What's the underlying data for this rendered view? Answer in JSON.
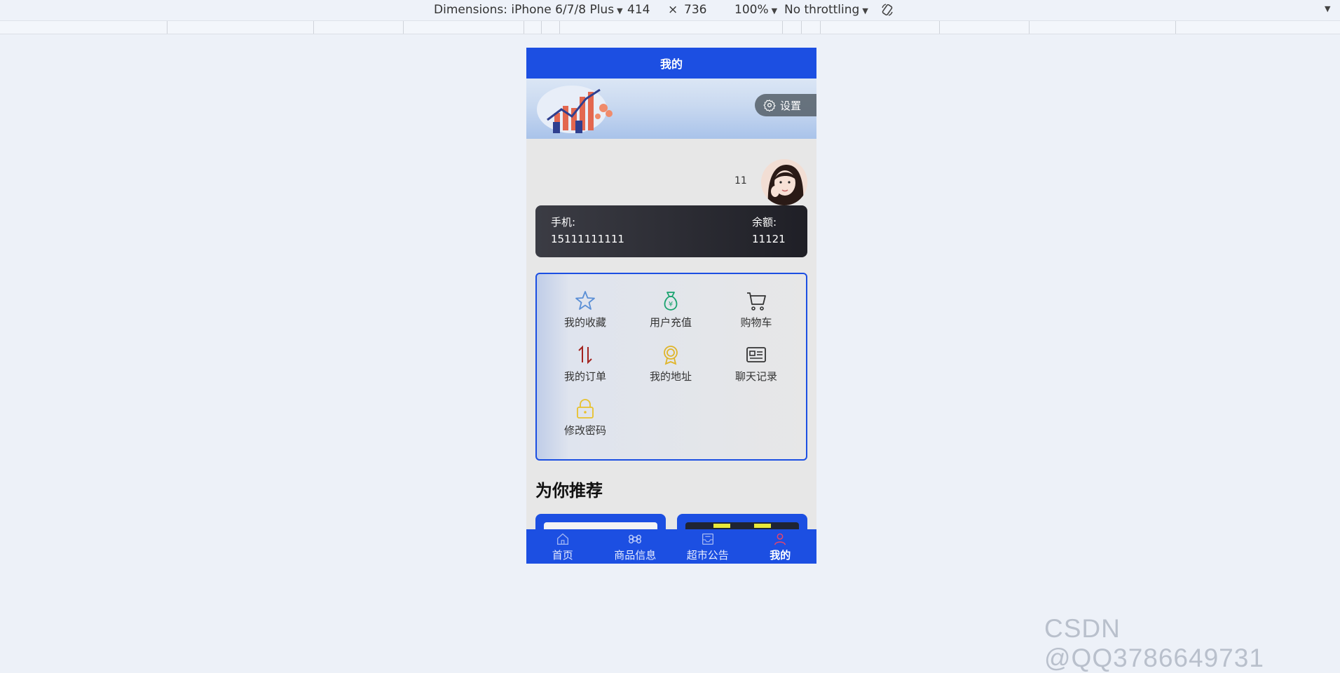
{
  "devtools": {
    "dimensions_label": "Dimensions: iPhone 6/7/8 Plus",
    "width": "414",
    "times": "×",
    "height": "736",
    "zoom": "100%",
    "throttling": "No throttling"
  },
  "app": {
    "header_title": "我的",
    "settings_label": "设置",
    "username": "11",
    "phone_label": "手机:",
    "phone_value": "15111111111",
    "balance_label": "余额:",
    "balance_value": "11121",
    "menu": [
      {
        "label": "我的收藏",
        "icon": "star-icon",
        "color": "#5b8fd6"
      },
      {
        "label": "用户充值",
        "icon": "money-bag-icon",
        "color": "#1aa36f"
      },
      {
        "label": "购物车",
        "icon": "cart-icon",
        "color": "#333333"
      },
      {
        "label": "我的订单",
        "icon": "up-down-arrows-icon",
        "color": "#a3231f"
      },
      {
        "label": "我的地址",
        "icon": "medal-icon",
        "color": "#e0b52a"
      },
      {
        "label": "聊天记录",
        "icon": "id-card-icon",
        "color": "#333333"
      },
      {
        "label": "修改密码",
        "icon": "lock-icon",
        "color": "#e8c12c"
      }
    ],
    "recommend_title": "为你推荐",
    "tabs": [
      {
        "label": "首页",
        "icon": "home-icon"
      },
      {
        "label": "商品信息",
        "icon": "command-icon"
      },
      {
        "label": "超市公告",
        "icon": "notice-icon"
      },
      {
        "label": "我的",
        "icon": "user-icon"
      }
    ],
    "accent_color": "#1c4fe2"
  },
  "watermark": "CSDN @QQ3786649731"
}
